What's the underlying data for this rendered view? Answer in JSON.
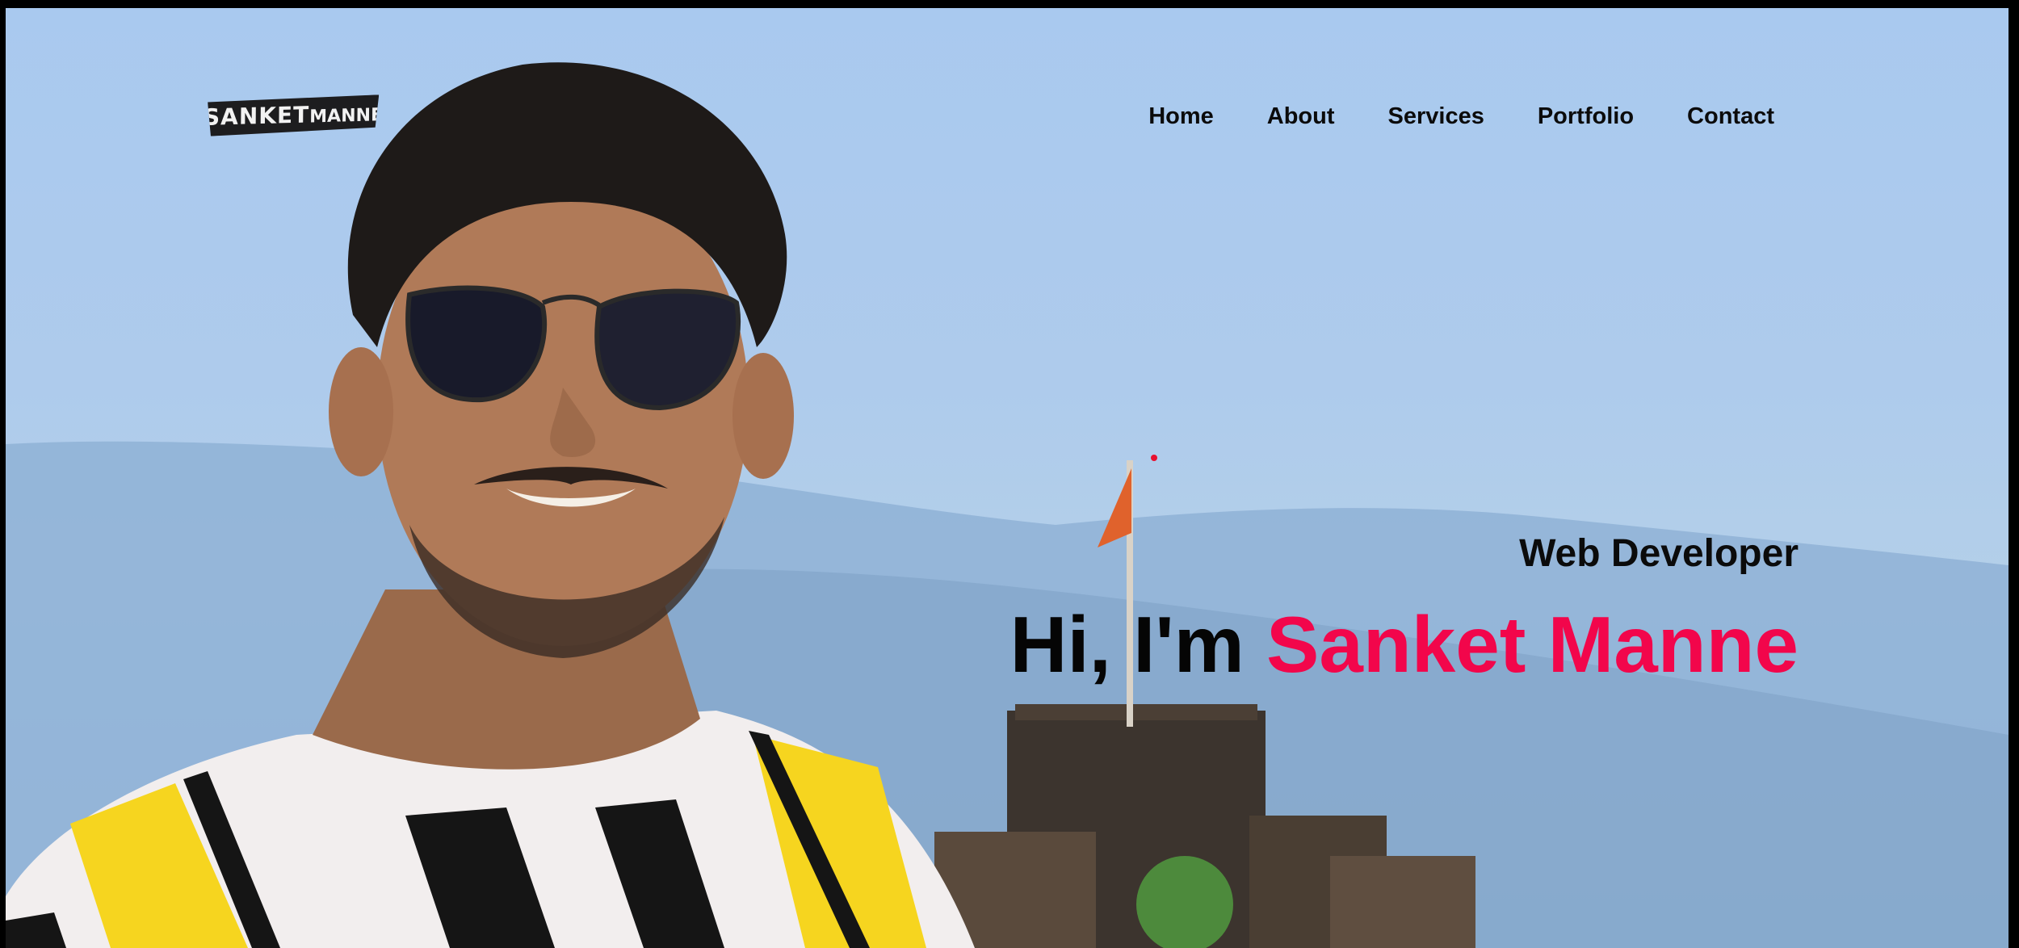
{
  "site": {
    "logo_text_main": "SANKET",
    "logo_text_small": "MANNE"
  },
  "nav": {
    "items": [
      {
        "label": "Home"
      },
      {
        "label": "About"
      },
      {
        "label": "Services"
      },
      {
        "label": "Portfolio"
      },
      {
        "label": "Contact"
      }
    ]
  },
  "hero": {
    "subtitle": "Web Developer",
    "greeting": "Hi, I'm",
    "name": "Sanket Manne"
  },
  "colors": {
    "accent": "#f2064b",
    "text": "#0b0b0b",
    "sky": "#a9c9ef",
    "logo_bg": "#1d1d1f"
  },
  "icons": {
    "cursor_dot": "red-dot-icon"
  }
}
